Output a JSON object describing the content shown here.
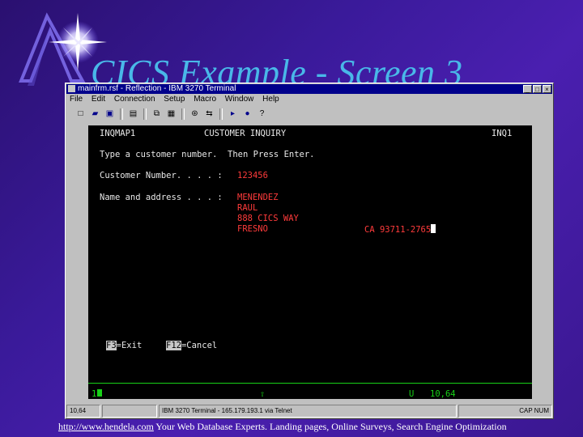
{
  "slide": {
    "title": "CICS Example - Screen 3"
  },
  "window": {
    "title": "mainfrm.rsf - Reflection - IBM 3270 Terminal",
    "buttons": [
      "_",
      "□",
      "×"
    ],
    "menu": [
      "File",
      "Edit",
      "Connection",
      "Setup",
      "Macro",
      "Window",
      "Help"
    ]
  },
  "toolbar": {
    "icons": [
      "new-icon",
      "open-icon",
      "save-icon",
      "print-icon",
      "copy-icon",
      "paste-icon",
      "connect-icon",
      "transfer-icon",
      "play-icon",
      "record-icon",
      "help-icon"
    ]
  },
  "terminal": {
    "map_name": "INQMAP1",
    "screen_title": "CUSTOMER INQUIRY",
    "trans_id": "INQ1",
    "instruction": "Type a customer number.  Then Press Enter.",
    "customer_number_label": "Customer Number. . . . :",
    "customer_number": "123456",
    "name_address_label": "Name and address . . . :",
    "last_name": "MENENDEZ",
    "first_name": "RAUL",
    "street": "888 CICS WAY",
    "city": "FRESNO",
    "state_zip": "CA 93711-2765",
    "pf3_key": "F3",
    "pf3_label": "=Exit",
    "pf12_key": "F12",
    "pf12_label": "=Cancel",
    "oia_left": "1",
    "oia_lock": "⇧",
    "oia_mode": "U",
    "oia_pos": "10,64"
  },
  "statusbar": {
    "cursor_pos": "10,64",
    "session_info": "IBM 3270 Terminal - 165.179.193.1 via Telnet",
    "indicators": "CAP NUM"
  },
  "footer": {
    "link_text": "http://www.hendela.com",
    "tagline": " Your Web Database Experts. Landing pages, Online Surveys, Search Engine Optimization"
  }
}
